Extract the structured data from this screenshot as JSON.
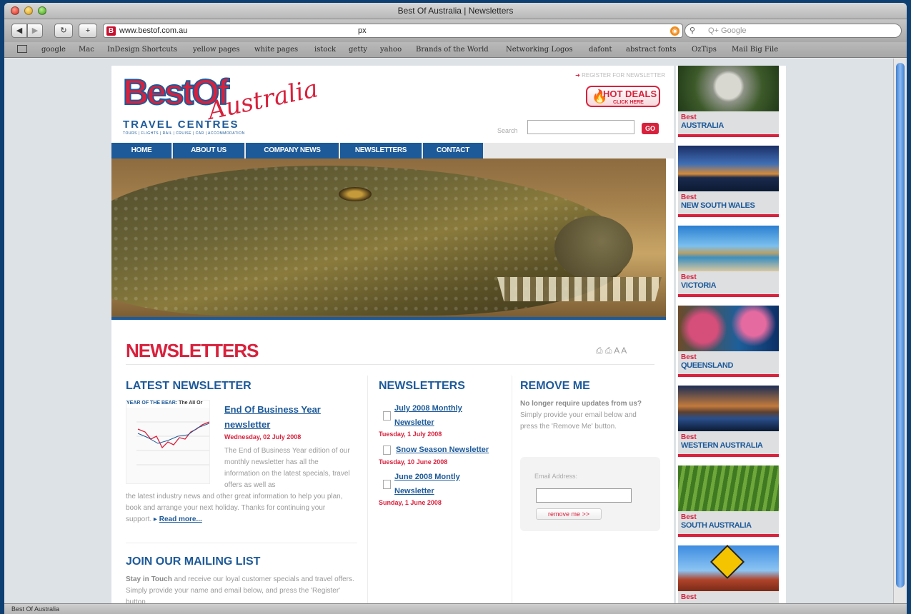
{
  "browser": {
    "window_title": "Best Of Australia | Newsletters",
    "url": "www.bestof.com.au",
    "url_extra": "px",
    "search_placeholder": "Q+ Google",
    "status_text": "Best Of Australia",
    "bookmarks": [
      "google",
      "Mac",
      "InDesign Shortcuts",
      "yellow pages",
      "white pages",
      "istock",
      "getty",
      "yahoo",
      "Brands of the World",
      "Networking Logos",
      "dafont",
      "abstract fonts",
      "OzTips",
      "Mail Big File"
    ]
  },
  "header": {
    "logo_best": "BestOf",
    "logo_script": "Australia",
    "logo_sub": "TRAVEL CENTRES",
    "logo_tiny": "TOURS | FLIGHTS | RAIL | CRUISE | CAR | ACCOMMODATION",
    "register_link": "REGISTER FOR NEWSLETTER",
    "hot_deals_line1": "HOT DEALS",
    "hot_deals_line2": "CLICK HERE",
    "search_label": "Search",
    "go_label": "GO"
  },
  "nav": [
    "HOME",
    "ABOUT US",
    "COMPANY NEWS",
    "NEWSLETTERS",
    "CONTACT"
  ],
  "page": {
    "heading": "NEWSLETTERS",
    "util_icons": "⎙ ⎙ A A"
  },
  "latest": {
    "title": "LATEST NEWSLETTER",
    "thumb_header_blue": "YEAR OF THE BEAR:",
    "thumb_header_dark": " The All Or",
    "item_title_1": "End Of Business Year",
    "item_title_2": "newsletter",
    "date": "Wednesday, 02 July 2008",
    "body_right": "The End of Business Year edition of our monthly newsletter has all the information on the latest specials, travel offers as well as",
    "body_full": "the latest industry news and other great information to help you plan, book and arrange your next holiday. Thanks for continuing your support.",
    "read_more": "Read more..."
  },
  "mailing": {
    "title": "JOIN OUR MAILING LIST",
    "lead": "Stay in Touch",
    "body": " and receive our loyal customer specials and travel offers. Simply provide your name and email below, and press the 'Register' button."
  },
  "newsletters": {
    "title": "NEWSLETTERS",
    "items": [
      {
        "line1": "July 2008 Monthly",
        "line2": "Newsletter",
        "date": "Tuesday, 1 July 2008"
      },
      {
        "line1": "Snow Season Newsletter",
        "line2": "",
        "date": "Tuesday, 10 June 2008"
      },
      {
        "line1": "June 2008 Montly",
        "line2": "Newsletter",
        "date": "Sunday, 1 June 2008"
      }
    ]
  },
  "remove": {
    "title": "REMOVE ME",
    "lead": "No longer require updates from us?",
    "body": " Simply provide your email below and press the 'Remove Me' button.",
    "email_label": "Email Address:",
    "button": "remove me >>"
  },
  "promos": [
    {
      "best": "Best",
      "name": "AUSTRALIA"
    },
    {
      "best": "Best",
      "name": "NEW SOUTH WALES"
    },
    {
      "best": "Best",
      "name": "VICTORIA"
    },
    {
      "best": "Best",
      "name": "QUEENSLAND"
    },
    {
      "best": "Best",
      "name": "WESTERN AUSTRALIA"
    },
    {
      "best": "Best",
      "name": "SOUTH AUSTRALIA"
    },
    {
      "best": "Best",
      "name": ""
    }
  ],
  "colors": {
    "brand_blue": "#1d5a99",
    "brand_red": "#d8213c"
  }
}
